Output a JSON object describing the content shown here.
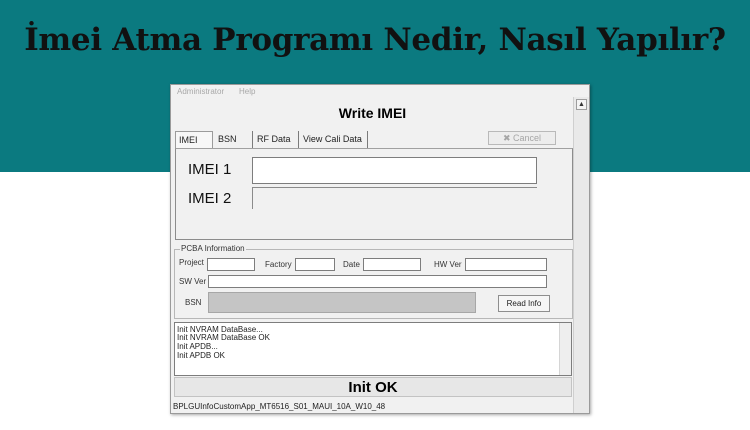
{
  "headline": "İmei Atma Programı Nedir, Nasıl Yapılır?",
  "window": {
    "menu": [
      "Administrator",
      "Help"
    ],
    "title": "Write IMEI",
    "tabs": [
      "IMEI",
      "BSN",
      "RF Data",
      "View Cali Data"
    ],
    "cancel_label": "✖ Cancel",
    "imei1_label": "IMEI 1",
    "imei2_label": "IMEI 2"
  },
  "pcba": {
    "title": "PCBA Information",
    "project_label": "Project",
    "factory_label": "Factory",
    "date_label": "Date",
    "hwver_label": "HW Ver",
    "swver_label": "SW Ver",
    "bsn_label": "BSN",
    "read_info_label": "Read Info"
  },
  "log": [
    "Init NVRAM DataBase...",
    "Init NVRAM DataBase OK",
    "Init APDB...",
    "Init APDB OK"
  ],
  "status_text": "Init OK",
  "statusbar_text": "BPLGUInfoCustomApp_MT6516_S01_MAUI_10A_W10_48",
  "colors": {
    "banner": "#0b7a80"
  }
}
